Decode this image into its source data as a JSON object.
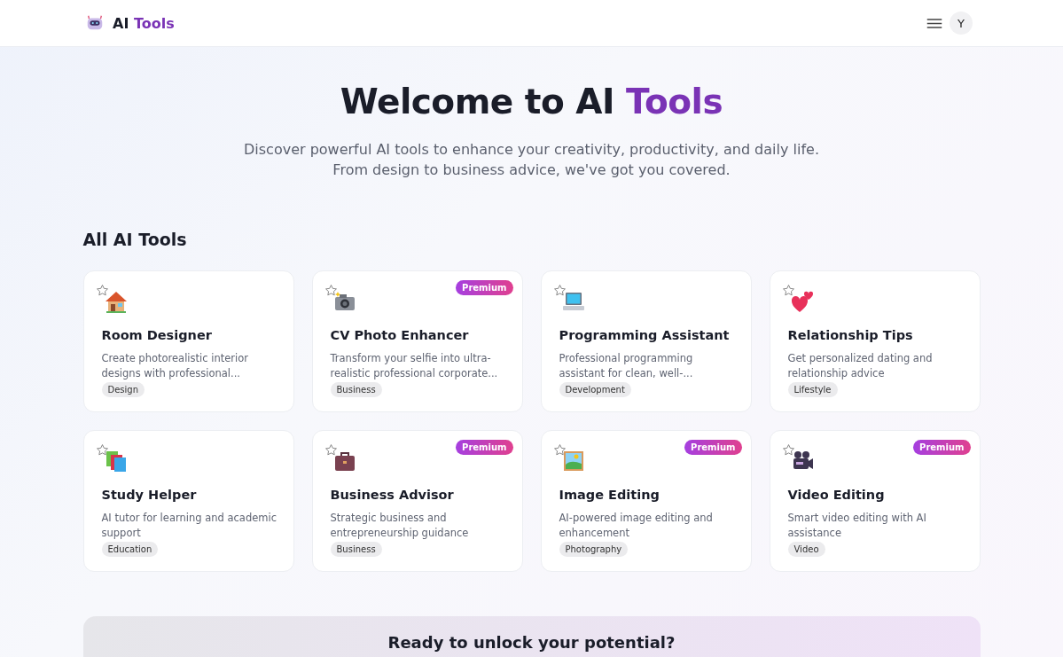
{
  "header": {
    "logo_prefix": "AI",
    "logo_highlight": "Tools",
    "avatar_initial": "Y"
  },
  "hero": {
    "title_prefix": "Welcome to AI",
    "title_highlight": "Tools",
    "subtitle_lines": [
      "Discover powerful AI tools to enhance your creativity, productivity, and daily life.",
      "From design to business advice, we've got you covered."
    ]
  },
  "section_title": "All AI Tools",
  "tools": [
    {
      "kind": "house",
      "title": "Room Designer",
      "description": "Create photorealistic interior designs with professional...",
      "tag": "Design",
      "favorite": false
    },
    {
      "kind": "camera",
      "title": "CV Photo Enhancer",
      "description": "Transform your selfie into ultra-realistic professional corporate...",
      "tag": "Business",
      "favorite": false,
      "badge": "Premium"
    },
    {
      "kind": "laptop",
      "title": "Programming Assistant",
      "description": "Professional programming assistant for clean, well-...",
      "tag": "Development",
      "favorite": false
    },
    {
      "kind": "hearts",
      "title": "Relationship Tips",
      "description": "Get personalized dating and relationship advice",
      "tag": "Lifestyle",
      "favorite": false
    },
    {
      "kind": "books",
      "title": "Study Helper",
      "description": "AI tutor for learning and academic support",
      "tag": "Education",
      "favorite": false
    },
    {
      "kind": "briefcase",
      "title": "Business Advisor",
      "description": "Strategic business and entrepreneurship guidance",
      "tag": "Business",
      "favorite": false,
      "badge": "Premium"
    },
    {
      "kind": "picture",
      "title": "Image Editing",
      "description": "AI-powered image editing and enhancement",
      "tag": "Photography",
      "favorite": false,
      "badge": "Premium"
    },
    {
      "kind": "movie-camera",
      "title": "Video Editing",
      "description": "Smart video editing with AI assistance",
      "tag": "Video",
      "favorite": false,
      "badge": "Premium"
    }
  ],
  "cta": {
    "title": "Ready to unlock your potential?"
  }
}
